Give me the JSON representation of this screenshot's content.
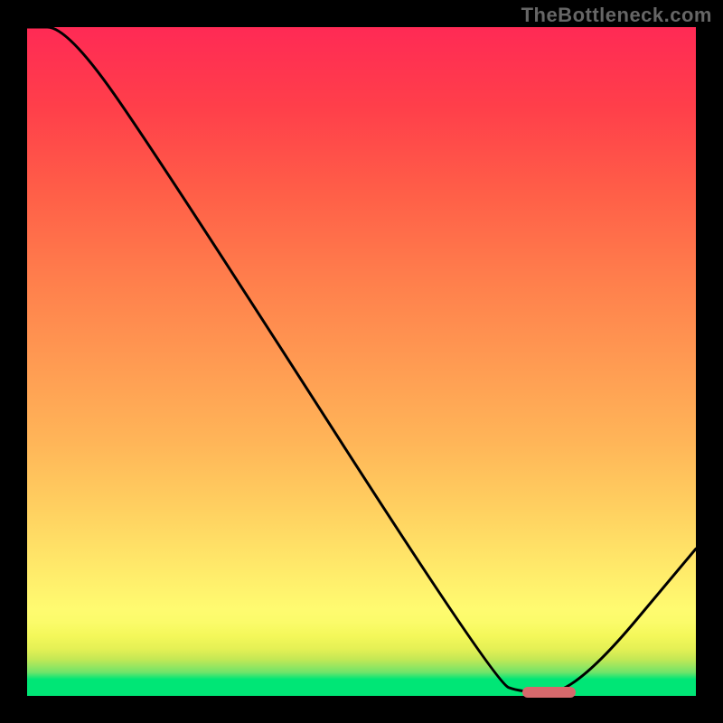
{
  "watermark": "TheBottleneck.com",
  "colors": {
    "background": "#000000",
    "gradient_top": "#ff2a55",
    "gradient_bottom": "#00e676",
    "curve": "#000000",
    "marker": "#d6696c",
    "watermark_text": "#666666"
  },
  "chart_data": {
    "type": "line",
    "title": "",
    "xlabel": "",
    "ylabel": "",
    "xlim": [
      0,
      100
    ],
    "ylim": [
      0,
      100
    ],
    "grid": false,
    "legend": false,
    "x": [
      0,
      6,
      20,
      70,
      74,
      82,
      100
    ],
    "values": [
      110,
      100,
      80,
      2,
      0.5,
      0.5,
      22
    ],
    "marker": {
      "x_start": 74,
      "x_end": 82,
      "y": 0.5
    },
    "notes": "Vertical gradient encodes bottleneck severity (red high → green low). Black curve shape over it; small rounded marker near minimum."
  }
}
